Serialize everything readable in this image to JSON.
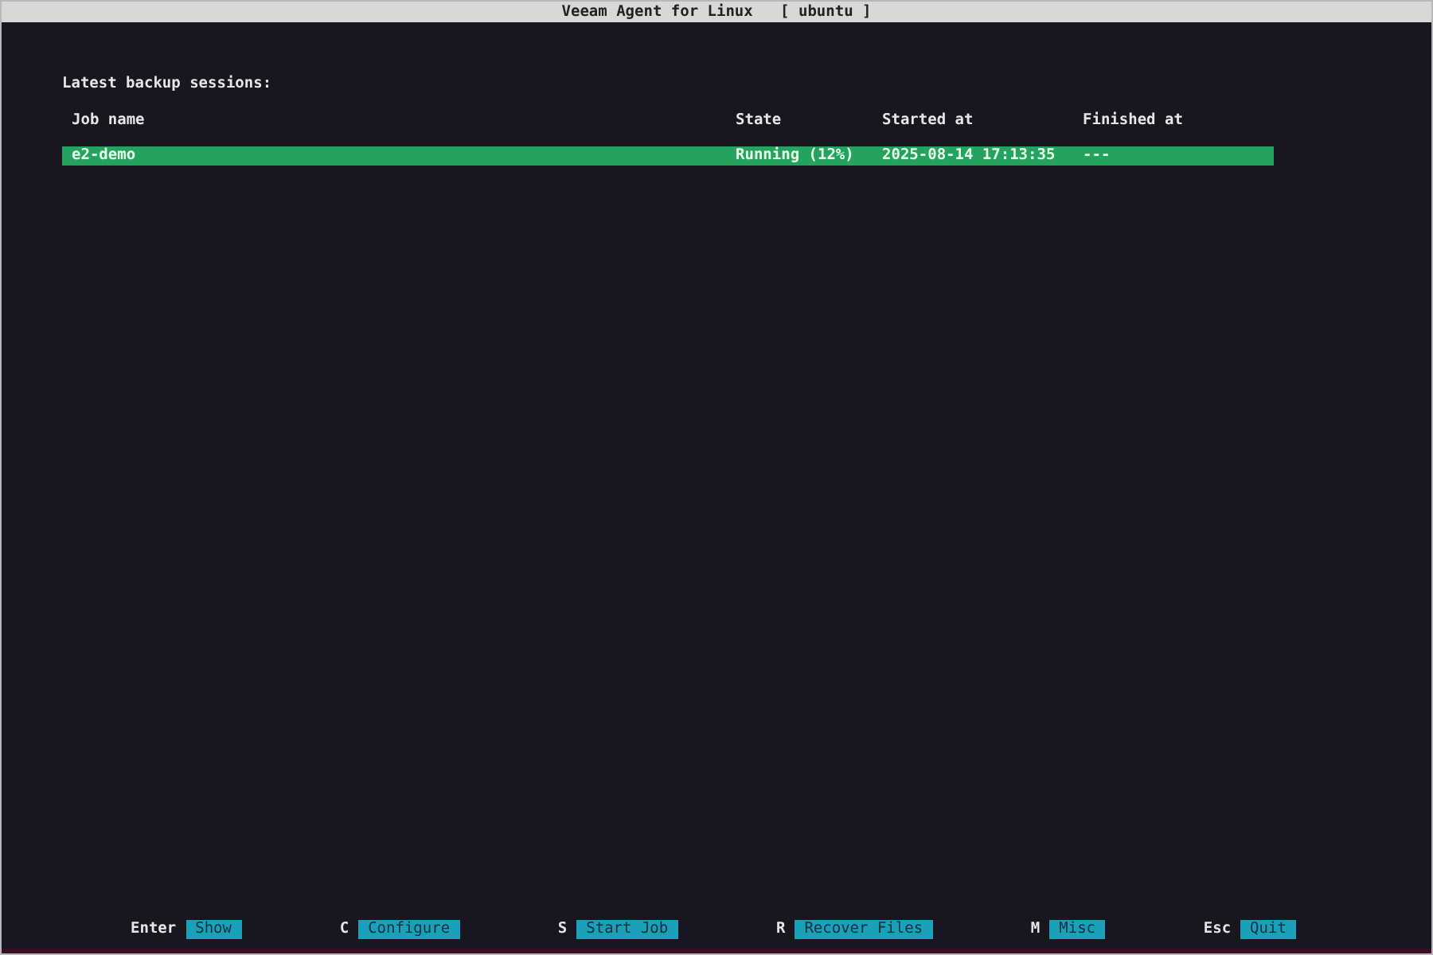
{
  "window": {
    "title": "Veeam Agent for Linux   [ ubuntu ]"
  },
  "heading": "Latest backup sessions:",
  "table": {
    "columns": [
      "Job name",
      "State",
      "Started at",
      "Finished at"
    ],
    "rows": [
      {
        "cells": [
          "e2-demo",
          "Running (12%)",
          "2025-08-14 17:13:35",
          "---"
        ],
        "selected": true
      }
    ]
  },
  "shortcuts": [
    {
      "key": "Enter",
      "label": "Show"
    },
    {
      "key": "C",
      "label": "Configure"
    },
    {
      "key": "S",
      "label": "Start Job"
    },
    {
      "key": "R",
      "label": "Recover Files"
    },
    {
      "key": "M",
      "label": "Misc"
    },
    {
      "key": "Esc",
      "label": "Quit"
    }
  ]
}
